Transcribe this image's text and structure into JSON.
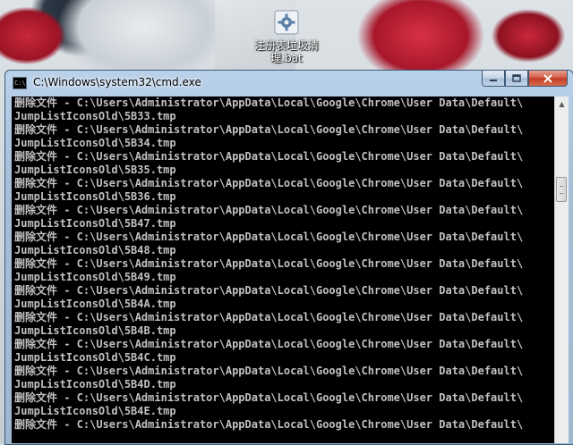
{
  "desktop": {
    "icon": {
      "name": "gear-batch-file-icon",
      "label_line1": "注册表垃圾清",
      "label_line2": "理.bat"
    }
  },
  "window": {
    "title": "C:\\Windows\\system32\\cmd.exe",
    "icon_text": "C:\\",
    "controls": {
      "minimize": "minimize",
      "maximize": "maximize",
      "close": "close"
    }
  },
  "console": {
    "lines": [
      "删除文件 - C:\\Users\\Administrator\\AppData\\Local\\Google\\Chrome\\User Data\\Default\\",
      "JumpListIconsOld\\5B33.tmp",
      "删除文件 - C:\\Users\\Administrator\\AppData\\Local\\Google\\Chrome\\User Data\\Default\\",
      "JumpListIconsOld\\5B34.tmp",
      "删除文件 - C:\\Users\\Administrator\\AppData\\Local\\Google\\Chrome\\User Data\\Default\\",
      "JumpListIconsOld\\5B35.tmp",
      "删除文件 - C:\\Users\\Administrator\\AppData\\Local\\Google\\Chrome\\User Data\\Default\\",
      "JumpListIconsOld\\5B36.tmp",
      "删除文件 - C:\\Users\\Administrator\\AppData\\Local\\Google\\Chrome\\User Data\\Default\\",
      "JumpListIconsOld\\5B47.tmp",
      "删除文件 - C:\\Users\\Administrator\\AppData\\Local\\Google\\Chrome\\User Data\\Default\\",
      "JumpListIconsOld\\5B48.tmp",
      "删除文件 - C:\\Users\\Administrator\\AppData\\Local\\Google\\Chrome\\User Data\\Default\\",
      "JumpListIconsOld\\5B49.tmp",
      "删除文件 - C:\\Users\\Administrator\\AppData\\Local\\Google\\Chrome\\User Data\\Default\\",
      "JumpListIconsOld\\5B4A.tmp",
      "删除文件 - C:\\Users\\Administrator\\AppData\\Local\\Google\\Chrome\\User Data\\Default\\",
      "JumpListIconsOld\\5B4B.tmp",
      "删除文件 - C:\\Users\\Administrator\\AppData\\Local\\Google\\Chrome\\User Data\\Default\\",
      "JumpListIconsOld\\5B4C.tmp",
      "删除文件 - C:\\Users\\Administrator\\AppData\\Local\\Google\\Chrome\\User Data\\Default\\",
      "JumpListIconsOld\\5B4D.tmp",
      "删除文件 - C:\\Users\\Administrator\\AppData\\Local\\Google\\Chrome\\User Data\\Default\\",
      "JumpListIconsOld\\5B4E.tmp",
      "删除文件 - C:\\Users\\Administrator\\AppData\\Local\\Google\\Chrome\\User Data\\Default\\"
    ]
  },
  "colors": {
    "console_bg": "#000000",
    "console_text": "#c0c0c0",
    "titlebar": "#a6bfd9",
    "close_button": "#c23b23"
  }
}
